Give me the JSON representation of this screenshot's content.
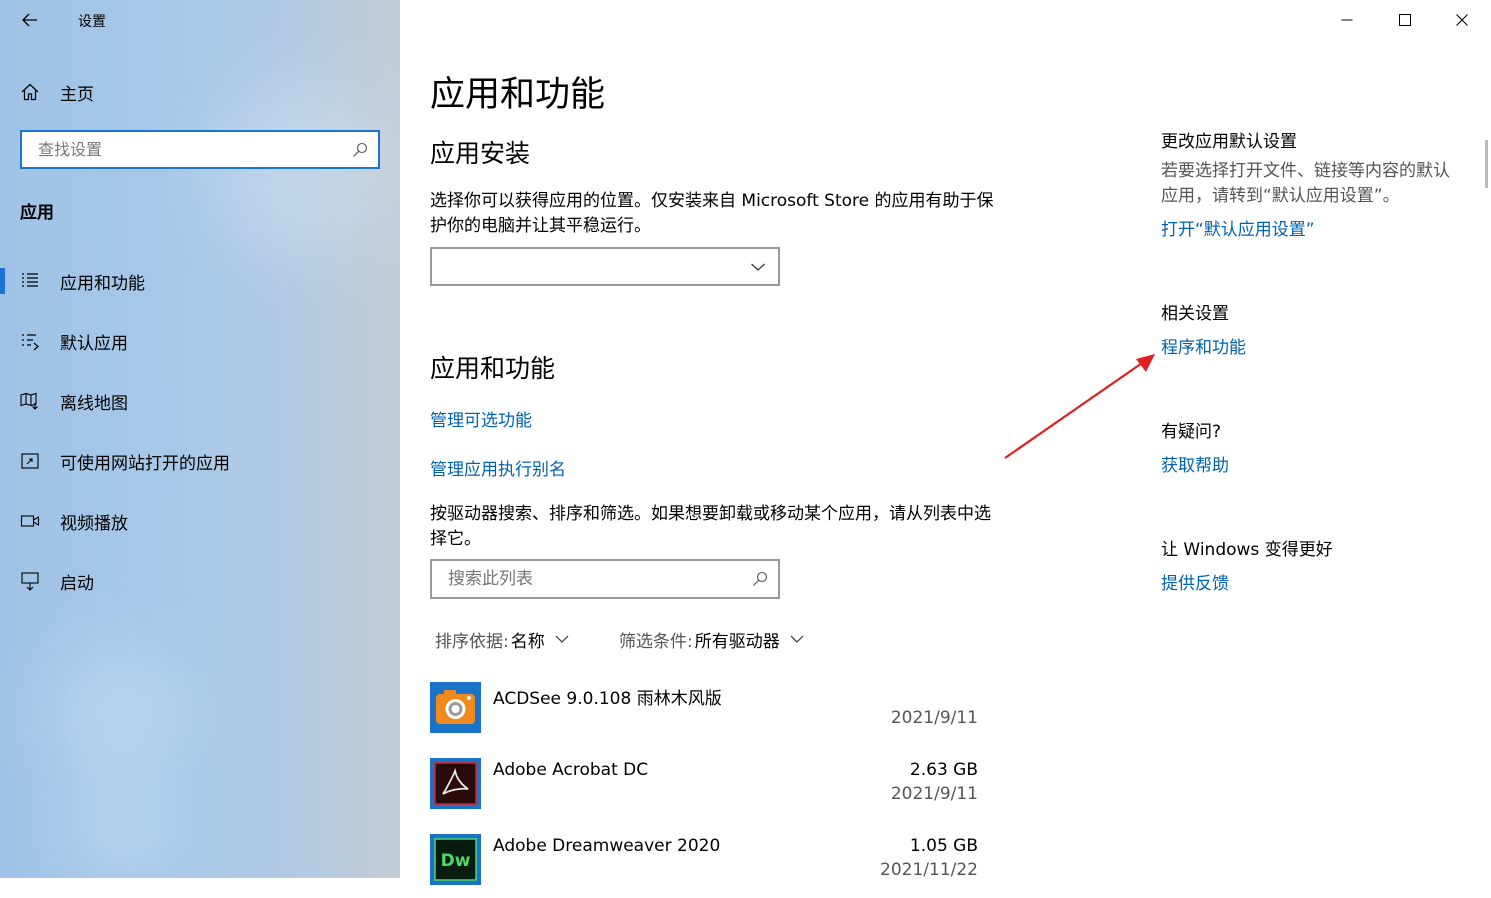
{
  "window": {
    "title": "设置"
  },
  "sidebar": {
    "home_label": "主页",
    "search_placeholder": "查找设置",
    "section_label": "应用",
    "items": [
      {
        "label": "应用和功能",
        "icon": "list-icon",
        "active": true
      },
      {
        "label": "默认应用",
        "icon": "default-apps-icon",
        "active": false
      },
      {
        "label": "离线地图",
        "icon": "map-icon",
        "active": false
      },
      {
        "label": "可使用网站打开的应用",
        "icon": "web-app-icon",
        "active": false
      },
      {
        "label": "视频播放",
        "icon": "video-icon",
        "active": false
      },
      {
        "label": "启动",
        "icon": "startup-icon",
        "active": false
      }
    ]
  },
  "main": {
    "page_title": "应用和功能",
    "install_heading": "应用安装",
    "install_desc": "选择你可以获得应用的位置。仅安装来自 Microsoft Store 的应用有助于保护你的电脑并让其平稳运行。",
    "install_dropdown_value": "",
    "features_heading": "应用和功能",
    "link_optional_features": "管理可选功能",
    "link_alias": "管理应用执行别名",
    "list_desc": "按驱动器搜索、排序和筛选。如果想要卸载或移动某个应用，请从列表中选择它。",
    "list_search_placeholder": "搜索此列表",
    "sort_label": "排序依据:",
    "sort_value": "名称",
    "filter_label": "筛选条件:",
    "filter_value": "所有驱动器",
    "apps": [
      {
        "name": "ACDSee 9.0.108 雨林木风版",
        "size": "",
        "date": "2021/9/11",
        "icon": "acdsee-icon"
      },
      {
        "name": "Adobe Acrobat DC",
        "size": "2.63 GB",
        "date": "2021/9/11",
        "icon": "acrobat-icon"
      },
      {
        "name": "Adobe Dreamweaver 2020",
        "size": "1.05 GB",
        "date": "2021/11/22",
        "icon": "dreamweaver-icon"
      }
    ]
  },
  "right_pane": {
    "default_heading": "更改应用默认设置",
    "default_desc": "若要选择打开文件、链接等内容的默认应用，请转到“默认应用设置”。",
    "default_link": "打开“默认应用设置”",
    "related_heading": "相关设置",
    "related_link": "程序和功能",
    "question_heading": "有疑问?",
    "help_link": "获取帮助",
    "feedback_heading": "让 Windows 变得更好",
    "feedback_link": "提供反馈"
  },
  "colors": {
    "accent": "#0063b1",
    "focus_border": "#1b75d0",
    "annotation_arrow": "#e02020"
  }
}
